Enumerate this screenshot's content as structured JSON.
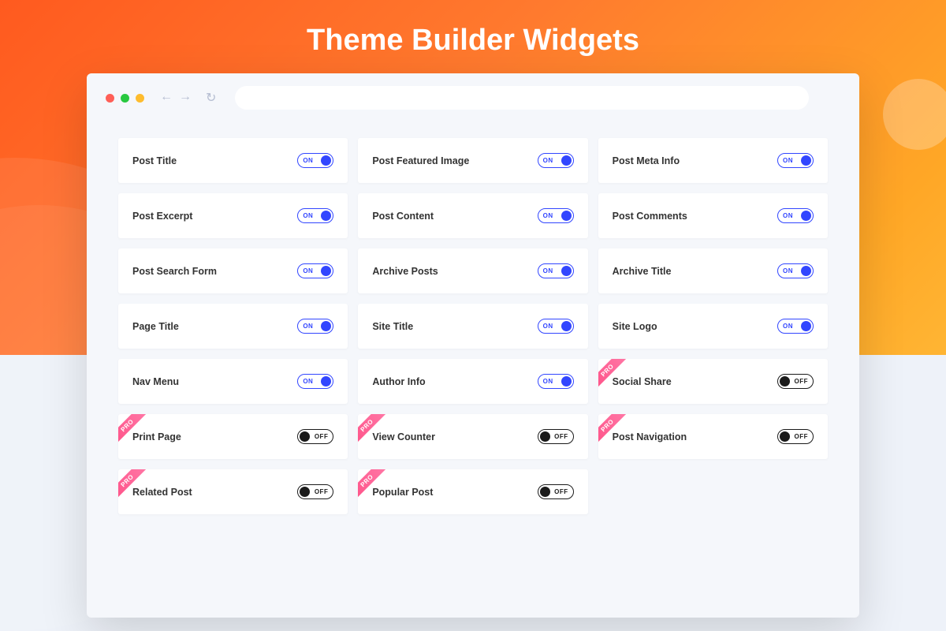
{
  "title": "Theme Builder Widgets",
  "toggleLabels": {
    "on": "ON",
    "off": "OFF"
  },
  "proBadge": "PRO",
  "widgets": [
    {
      "label": "Post Title",
      "on": true,
      "pro": false
    },
    {
      "label": "Post Featured Image",
      "on": true,
      "pro": false
    },
    {
      "label": "Post Meta Info",
      "on": true,
      "pro": false
    },
    {
      "label": "Post Excerpt",
      "on": true,
      "pro": false
    },
    {
      "label": "Post Content",
      "on": true,
      "pro": false
    },
    {
      "label": "Post Comments",
      "on": true,
      "pro": false
    },
    {
      "label": "Post Search Form",
      "on": true,
      "pro": false
    },
    {
      "label": "Archive Posts",
      "on": true,
      "pro": false
    },
    {
      "label": "Archive Title",
      "on": true,
      "pro": false
    },
    {
      "label": "Page Title",
      "on": true,
      "pro": false
    },
    {
      "label": "Site Title",
      "on": true,
      "pro": false
    },
    {
      "label": "Site Logo",
      "on": true,
      "pro": false
    },
    {
      "label": "Nav Menu",
      "on": true,
      "pro": false
    },
    {
      "label": "Author Info",
      "on": true,
      "pro": false
    },
    {
      "label": "Social Share",
      "on": false,
      "pro": true
    },
    {
      "label": "Print Page",
      "on": false,
      "pro": true
    },
    {
      "label": "View Counter",
      "on": false,
      "pro": true
    },
    {
      "label": "Post Navigation",
      "on": false,
      "pro": true
    },
    {
      "label": "Related Post",
      "on": false,
      "pro": true
    },
    {
      "label": "Popular Post",
      "on": false,
      "pro": true
    }
  ]
}
